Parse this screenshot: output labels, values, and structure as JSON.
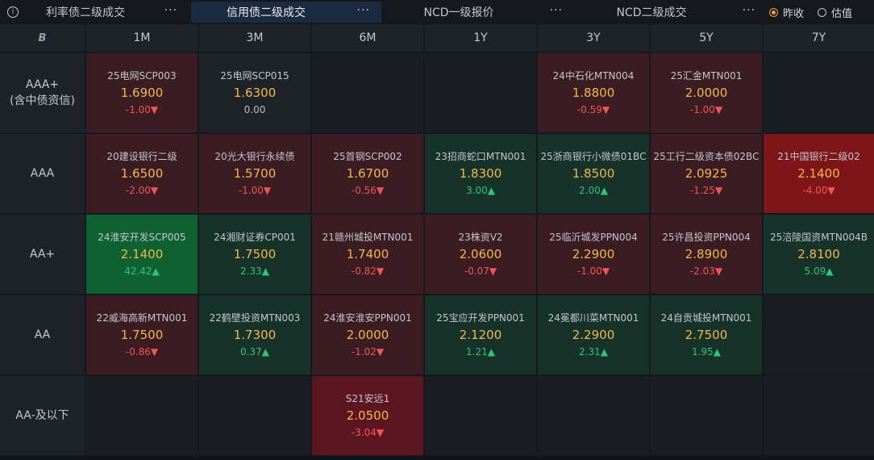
{
  "tabs": [
    {
      "label": "利率债二级成交",
      "active": false
    },
    {
      "label": "信用债二级成交",
      "active": true
    },
    {
      "label": "NCD一级报价",
      "active": false
    },
    {
      "label": "NCD二级成交",
      "active": false
    }
  ],
  "tab_more": "···",
  "info_icon": "i",
  "radios": [
    {
      "label": "昨收",
      "checked": true
    },
    {
      "label": "估值",
      "checked": false
    }
  ],
  "corner_label": "B",
  "columns": [
    "1M",
    "3M",
    "6M",
    "1Y",
    "3Y",
    "5Y",
    "7Y"
  ],
  "rows": [
    {
      "label": "AAA+",
      "sublabel": "(含中债资信)"
    },
    {
      "label": "AAA",
      "sublabel": ""
    },
    {
      "label": "AA+",
      "sublabel": ""
    },
    {
      "label": "AA",
      "sublabel": ""
    },
    {
      "label": "AA-及以下",
      "sublabel": ""
    }
  ],
  "cells": [
    [
      {
        "name": "25电网SCP003",
        "price": "1.6900",
        "change": "-1.00▼",
        "dir": "dn",
        "bg": "bg-red1"
      },
      {
        "name": "25电网SCP015",
        "price": "1.6300",
        "change": "0.00",
        "dir": "neu",
        "bg": "bg-neu"
      },
      null,
      null,
      {
        "name": "24中石化MTN004",
        "price": "1.8800",
        "change": "-0.59▼",
        "dir": "dn",
        "bg": "bg-red1"
      },
      {
        "name": "25汇金MTN001",
        "price": "2.0000",
        "change": "-1.00▼",
        "dir": "dn",
        "bg": "bg-red1"
      },
      null
    ],
    [
      {
        "name": "20建设银行二级",
        "price": "1.6500",
        "change": "-2.00▼",
        "dir": "dn",
        "bg": "bg-red1"
      },
      {
        "name": "20光大银行永续债",
        "price": "1.5700",
        "change": "-1.00▼",
        "dir": "dn",
        "bg": "bg-red1"
      },
      {
        "name": "25首钢SCP002",
        "price": "1.6700",
        "change": "-0.56▼",
        "dir": "dn",
        "bg": "bg-red1"
      },
      {
        "name": "23招商蛇口MTN001",
        "price": "1.8300",
        "change": "3.00▲",
        "dir": "up",
        "bg": "bg-grn1"
      },
      {
        "name": "25浙商银行小微债01BC",
        "price": "1.8500",
        "change": "2.00▲",
        "dir": "up",
        "bg": "bg-grn1"
      },
      {
        "name": "25工行二级资本债02BC",
        "price": "2.0925",
        "change": "-1.25▼",
        "dir": "dn",
        "bg": "bg-red1"
      },
      {
        "name": "21中国银行二级02",
        "price": "2.1400",
        "change": "-4.00▼",
        "dir": "dn",
        "bg": "bg-red3"
      }
    ],
    [
      {
        "name": "24淮安开发SCP005",
        "price": "2.1400",
        "change": "42.42▲",
        "dir": "up",
        "bg": "bg-grn2"
      },
      {
        "name": "24湘财证券CP001",
        "price": "1.7500",
        "change": "2.33▲",
        "dir": "up",
        "bg": "bg-grn1"
      },
      {
        "name": "21赣州城投MTN001",
        "price": "1.7400",
        "change": "-0.82▼",
        "dir": "dn",
        "bg": "bg-red1"
      },
      {
        "name": "23株资V2",
        "price": "2.0600",
        "change": "-0.07▼",
        "dir": "dn",
        "bg": "bg-red1"
      },
      {
        "name": "25临沂城发PPN004",
        "price": "2.2900",
        "change": "-1.00▼",
        "dir": "dn",
        "bg": "bg-red1"
      },
      {
        "name": "25许昌投资PPN004",
        "price": "2.8900",
        "change": "-2.03▼",
        "dir": "dn",
        "bg": "bg-red1"
      },
      {
        "name": "25涪陵国资MTN004B",
        "price": "2.8100",
        "change": "5.09▲",
        "dir": "up",
        "bg": "bg-grn1"
      }
    ],
    [
      {
        "name": "22威海高新MTN001",
        "price": "1.7500",
        "change": "-0.86▼",
        "dir": "dn",
        "bg": "bg-red1"
      },
      {
        "name": "22鹤壁投资MTN003",
        "price": "1.7300",
        "change": "0.37▲",
        "dir": "up",
        "bg": "bg-grn1"
      },
      {
        "name": "24淮安淮安PPN001",
        "price": "2.0000",
        "change": "-1.02▼",
        "dir": "dn",
        "bg": "bg-red1"
      },
      {
        "name": "25宝应开发PPN001",
        "price": "2.1200",
        "change": "1.21▲",
        "dir": "up",
        "bg": "bg-grn1"
      },
      {
        "name": "24冕都川菜MTN001",
        "price": "2.2900",
        "change": "2.31▲",
        "dir": "up",
        "bg": "bg-grn1"
      },
      {
        "name": "24自贡城投MTN001",
        "price": "2.7500",
        "change": "1.95▲",
        "dir": "up",
        "bg": "bg-grn1"
      },
      null
    ],
    [
      null,
      null,
      {
        "name": "S21安远1",
        "price": "2.0500",
        "change": "-3.04▼",
        "dir": "dn",
        "bg": "bg-red2"
      },
      null,
      null,
      null,
      null
    ]
  ]
}
